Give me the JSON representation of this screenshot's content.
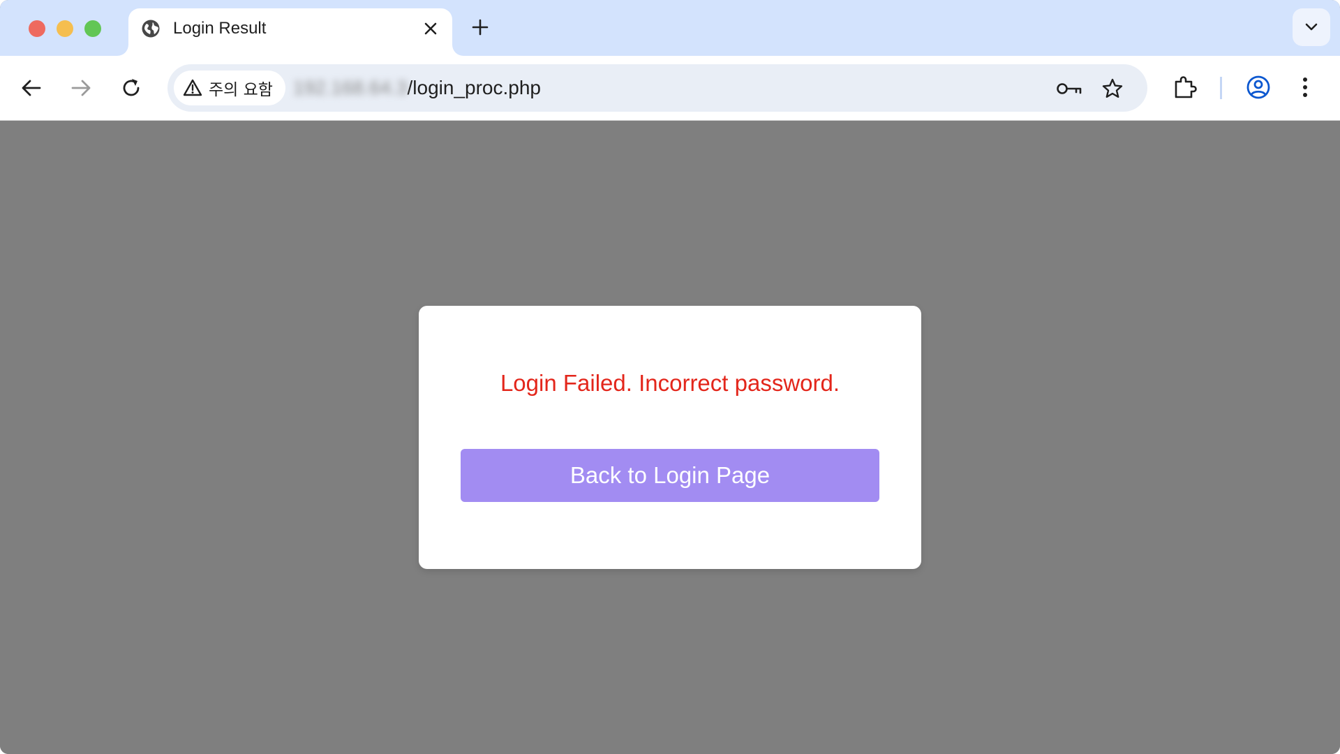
{
  "browser": {
    "tab": {
      "title": "Login Result",
      "favicon": "globe-icon"
    },
    "toolbar": {
      "security_chip_label": "주의 요함",
      "security_icon": "warning-triangle-icon",
      "url_host_blurred": "192.168.64.3",
      "url_path": "/login_proc.php"
    },
    "colors": {
      "tabstrip": "#d3e3fd",
      "omnibox": "#e9eef6",
      "profile_accent": "#0b57d0"
    }
  },
  "page": {
    "background_color": "#7f7f7f",
    "error_message": "Login Failed. Incorrect password.",
    "error_color": "#e3261b",
    "back_button_label": "Back to Login Page",
    "button_color": "#a28cf2"
  }
}
